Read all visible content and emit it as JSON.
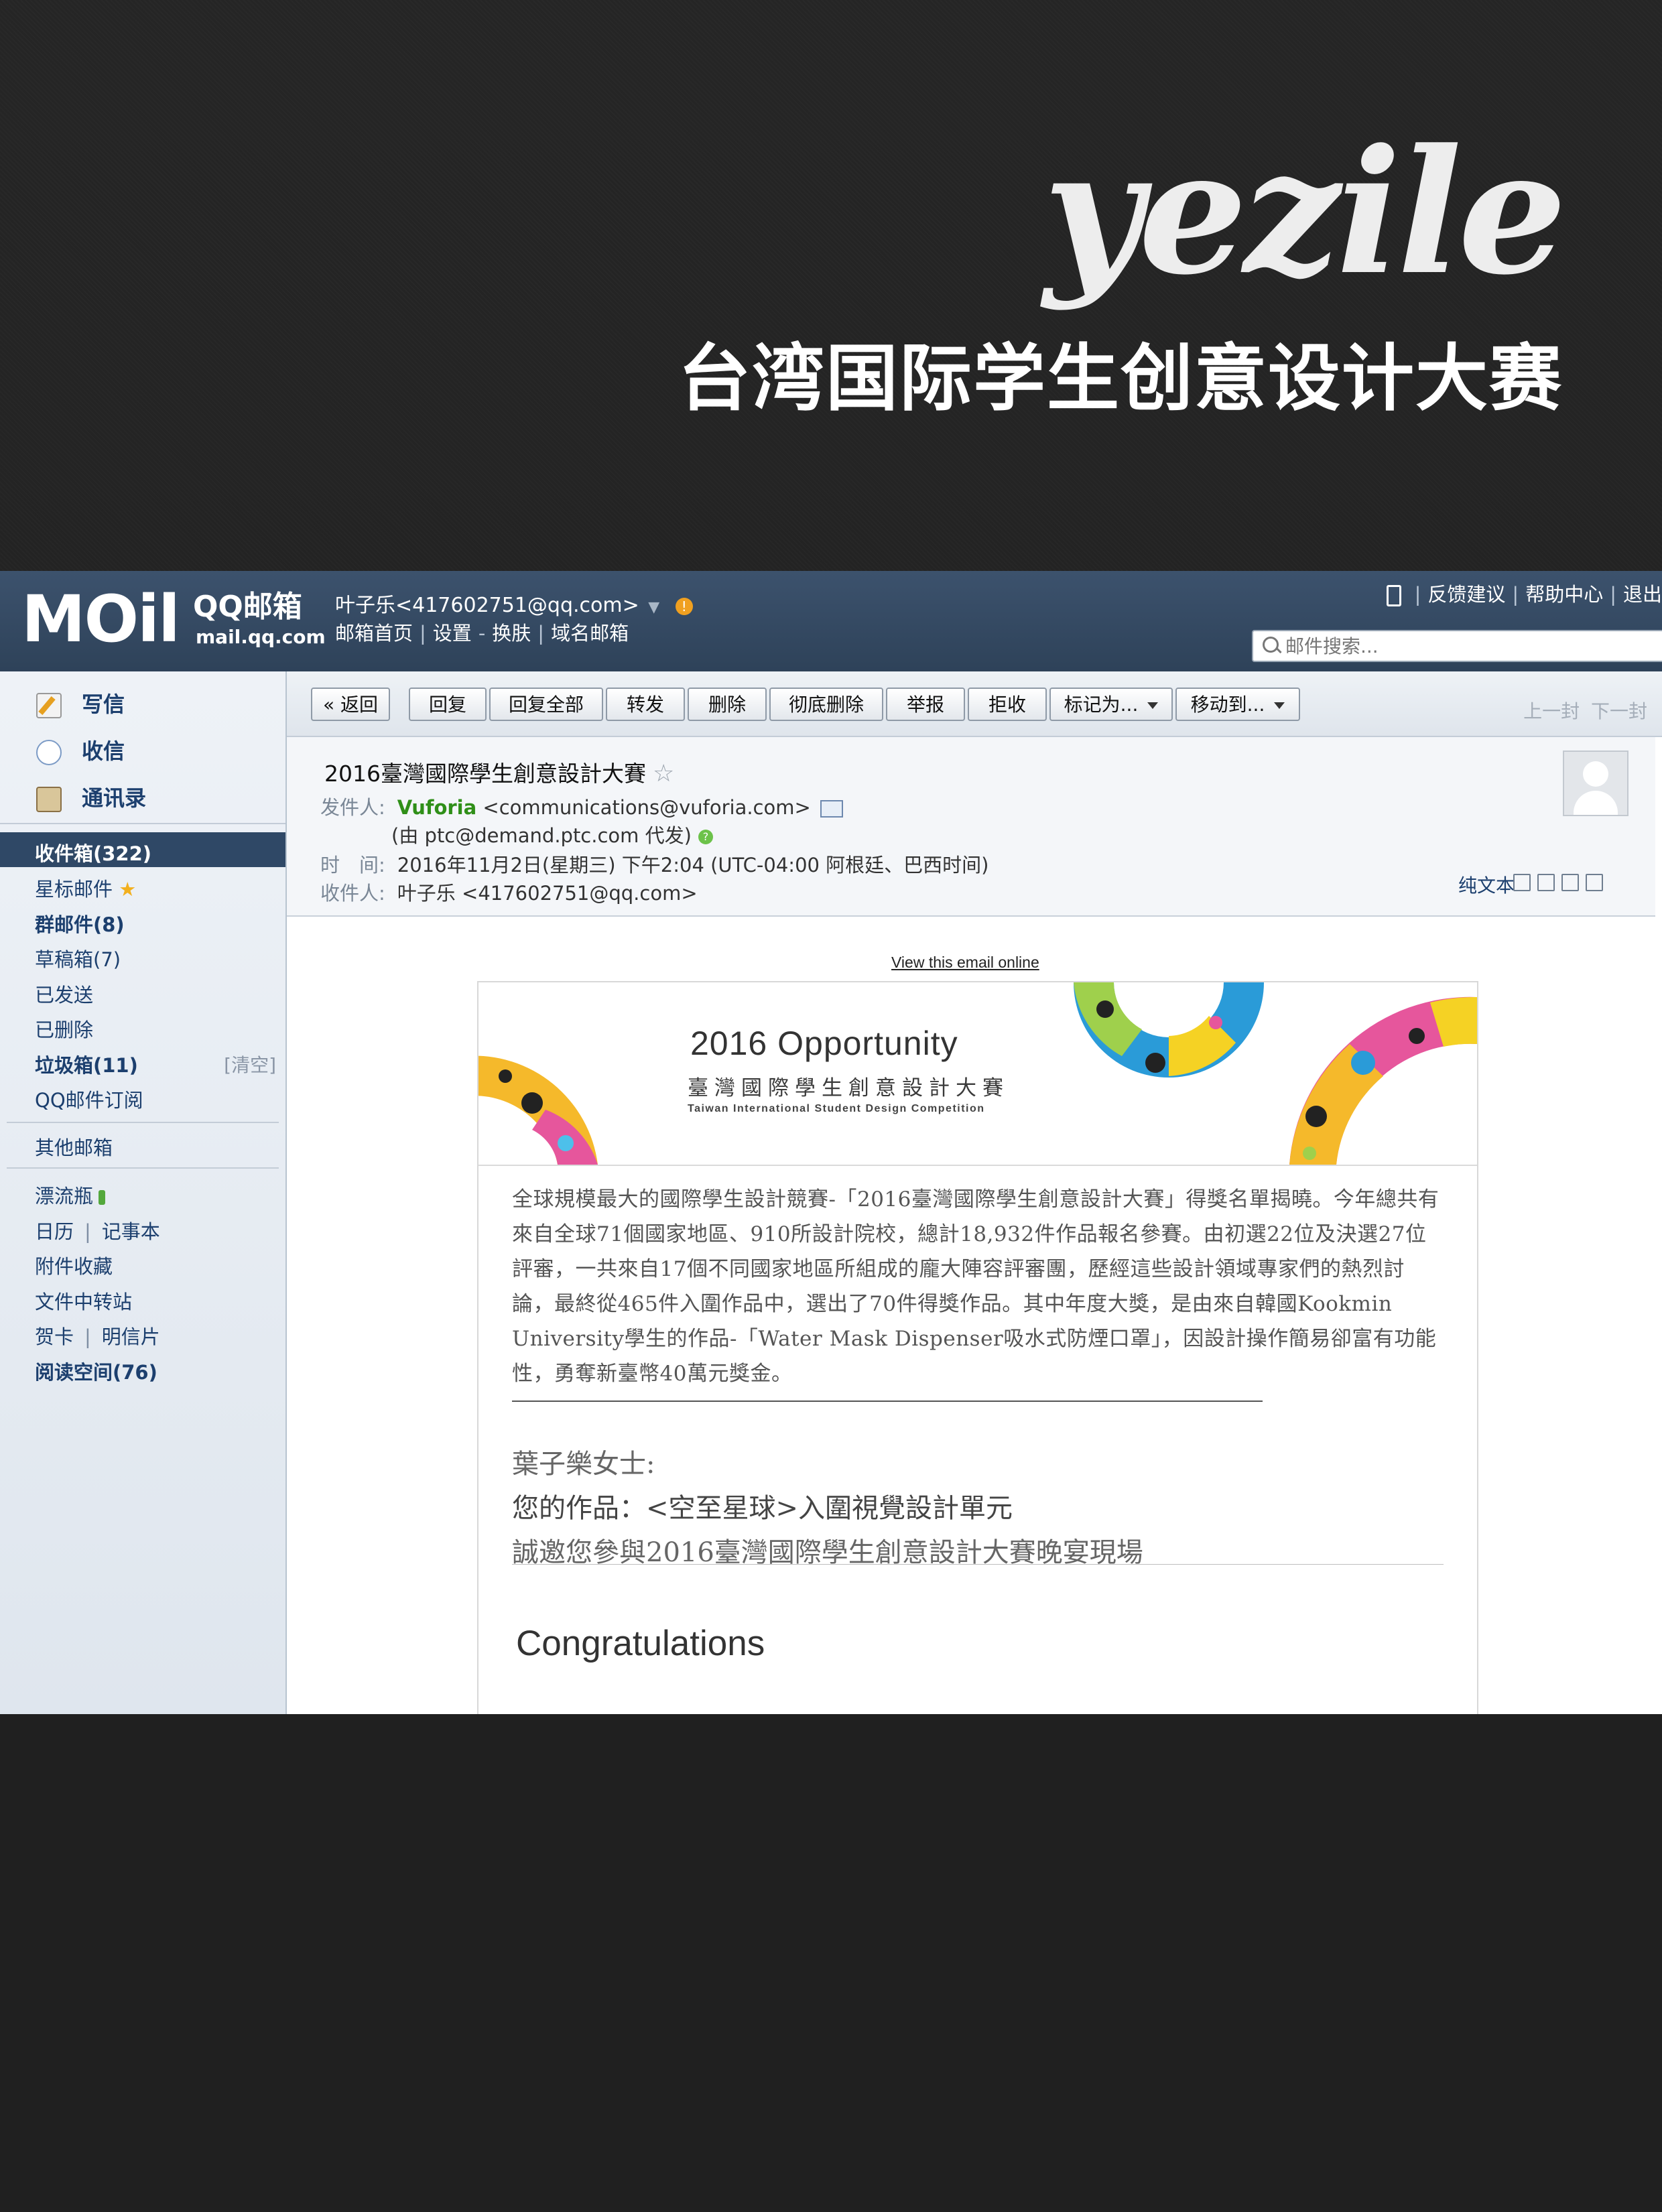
{
  "cover": {
    "brand": "yezile",
    "title": "台湾国际学生创意设计大赛"
  },
  "header": {
    "logo_main": "MOil",
    "logo_service": "QQ邮箱",
    "logo_domain": "mail.qq.com",
    "user": "叶子乐<417602751@qq.com>",
    "user_arrow": "▼",
    "user_links": [
      "邮箱首页",
      "设置",
      "换肤",
      "域名邮箱"
    ],
    "top_links": [
      "反馈建议",
      "帮助中心",
      "退出"
    ],
    "search_placeholder": "邮件搜索..."
  },
  "sidebar": {
    "actions": [
      "写信",
      "收信",
      "通讯录"
    ],
    "folders": [
      "收件箱(322)",
      "星标邮件",
      "群邮件(8)",
      "草稿箱(7)",
      "已发送",
      "已删除",
      "垃圾箱(11)",
      "QQ邮件订阅"
    ],
    "clear_label": "[清空]",
    "other_mailbox": "其他邮箱",
    "apps": {
      "drift": "漂流瓶",
      "calendar": "日历",
      "notebook": "记事本",
      "attachments": "附件收藏",
      "file_transfer": "文件中转站",
      "greeting_card": "贺卡",
      "postcard": "明信片",
      "reading": "阅读空间(76)"
    }
  },
  "toolbar": {
    "back": "« 返回",
    "reply": "回复",
    "reply_all": "回复全部",
    "forward": "转发",
    "delete": "删除",
    "delete_permanent": "彻底删除",
    "report": "举报",
    "reject": "拒收",
    "mark_as": "标记为...",
    "move_to": "移动到...",
    "prev": "上一封",
    "next": "下一封"
  },
  "mail": {
    "subject": "2016臺灣國際學生創意設計大賽",
    "from_label": "发件人:",
    "from_name": "Vuforia",
    "from_addr": "<communications@vuforia.com>",
    "via": "(由 ptc@demand.ptc.com 代发)",
    "time_label": "时　间:",
    "time": "2016年11月2日(星期三) 下午2:04 (UTC-04:00 阿根廷、巴西时间)",
    "to_label": "收件人:",
    "to_name": "叶子乐",
    "to_addr": "<417602751@qq.com>",
    "plain_text": "纯文本"
  },
  "email_body": {
    "view_online": "View this email online",
    "banner_title": "2016 Opportunity",
    "banner_cn": "臺灣國際學生創意設計大賽",
    "banner_en": "Taiwan International Student Design Competition",
    "paragraph": "全球規模最大的國際學生設計競賽-「2016臺灣國際學生創意設計大賽」得獎名單揭曉。今年總共有來自全球71個國家地區、910所設計院校，總計18,932件作品報名參賽。由初選22位及決選27位評審，一共來自17個不同國家地區所組成的龐大陣容評審團，歷經這些設計領域專家們的熱烈討論，最終從465件入圍作品中，選出了70件得獎作品。其中年度大獎，是由來自韓國Kookmin University學生的作品-「Water Mask Dispenser吸水式防煙口罩」，因設計操作簡易卻富有功能性，勇奪新臺幣40萬元獎金。",
    "greeting": "葉子樂女士:",
    "work": "您的作品：<空至星球>入圍視覺設計單元",
    "invite": "誠邀您參與2016臺灣國際學生創意設計大賽晚宴現場",
    "congrats": "Congratulations"
  },
  "colors": {
    "header_bg": "#34495f",
    "sidebar_active": "#2f4866",
    "link": "#1c3f6e",
    "sender_green": "#2f8f18",
    "page_bg": "#232323"
  }
}
